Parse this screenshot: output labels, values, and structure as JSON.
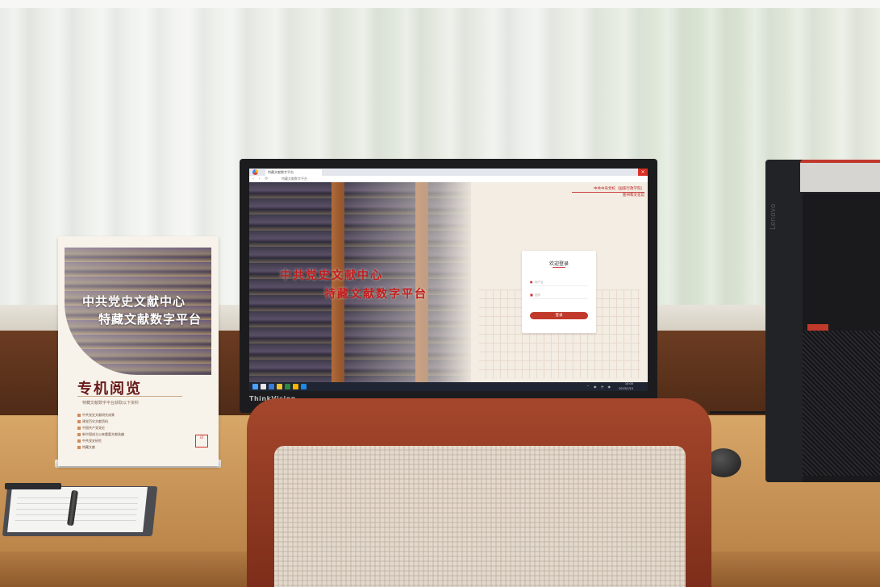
{
  "sign": {
    "title_line1": "中共党史文献中心",
    "title_line2": "特藏文献数字平台",
    "heading": "专机阅览",
    "subtitle": "特藏文献数字平台获取以下资料",
    "items": [
      "中共党史文献研究成果",
      "建党百年文献资料",
      "中国共产党党史",
      "新中国成立以来重要文献选编",
      "中共党史研究",
      "特藏文献"
    ]
  },
  "monitor": {
    "brand": "ThinkVision",
    "browser": {
      "tab_label": "特藏文献数字平台",
      "address": "特藏文献数字平台"
    },
    "page": {
      "hero_line1": "中共党史文献中心",
      "hero_line2": "特藏文献数字平台",
      "logo_line1": "中共中央党校（国家行政学院）",
      "logo_line2": "图书和文化馆",
      "login": {
        "title": "欢迎登录",
        "username_placeholder": "用户名",
        "password_placeholder": "密码",
        "submit_label": "登录"
      }
    },
    "taskbar": {
      "time": "10:00",
      "date": "2023/7/15"
    }
  },
  "tower": {
    "brand": "Lenovo"
  },
  "colors": {
    "accent_red": "#c0392b",
    "hero_red": "#c21d1d",
    "desk": "#c99558",
    "wood": "#4e2a16"
  }
}
